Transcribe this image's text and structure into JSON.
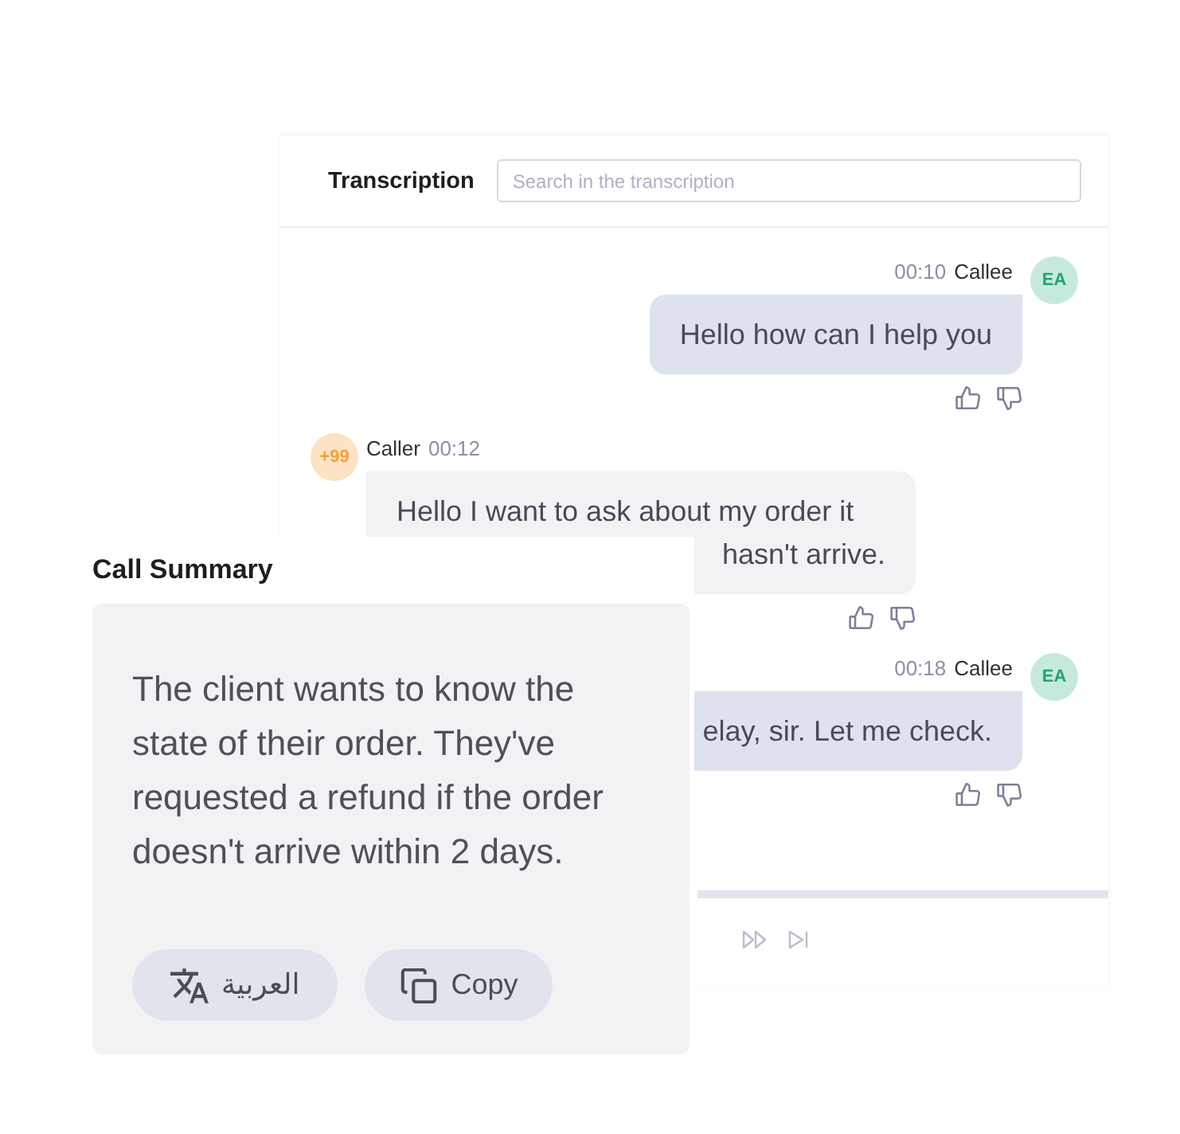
{
  "transcription": {
    "title": "Transcription",
    "search": {
      "placeholder": "Search in the transcription"
    },
    "messages": [
      {
        "kind": "callee",
        "time": "00:10",
        "speaker": "Callee",
        "avatar": "EA",
        "lines": [
          "Hello how can I help you"
        ]
      },
      {
        "kind": "caller",
        "time": "00:12",
        "speaker": "Caller",
        "avatar": "+99",
        "lines": [
          "Hello I want to ask about my order it",
          "hasn't arrive."
        ]
      },
      {
        "kind": "callee",
        "time": "00:18",
        "speaker": "Callee",
        "avatar": "EA",
        "lines": [
          "elay, sir. Let me check."
        ]
      }
    ]
  },
  "player": {
    "controls": [
      {
        "kind": "fast_forward"
      },
      {
        "kind": "skip_next"
      }
    ]
  },
  "call_summary": {
    "title": "Call Summary",
    "text": "The client wants to know the state of their order. They've requested a refund if the order doesn't arrive within 2 days.",
    "buttons": [
      {
        "kind": "translate",
        "label": "العربية"
      },
      {
        "kind": "copy",
        "label": "Copy"
      }
    ]
  }
}
